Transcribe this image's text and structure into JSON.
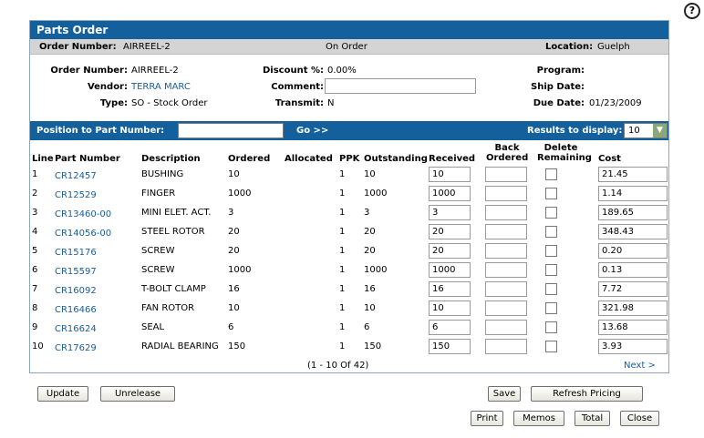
{
  "help_label": "?",
  "title": "Parts Order",
  "infobar": {
    "order_label": "Order Number:",
    "order_value": "AIRREEL-2",
    "status": "On Order",
    "location_label": "Location:",
    "location_value": "Guelph"
  },
  "details": {
    "order_number_label": "Order Number:",
    "order_number": "AIRREEL-2",
    "vendor_label": "Vendor:",
    "vendor": "TERRA MARC",
    "type_label": "Type:",
    "type": "SO - Stock Order",
    "discount_label": "Discount %:",
    "discount": "0.00%",
    "comment_label": "Comment:",
    "comment": "",
    "transmit_label": "Transmit:",
    "transmit": "N",
    "program_label": "Program:",
    "program": "",
    "ship_date_label": "Ship Date:",
    "ship_date": "",
    "due_date_label": "Due Date:",
    "due_date": "01/23/2009"
  },
  "position": {
    "label": "Position to Part Number:",
    "value": "",
    "go_label": "Go >>",
    "results_label": "Results to display:",
    "results_value": "10"
  },
  "columns": {
    "line": "Line",
    "part": "Part Number",
    "desc": "Description",
    "ordered": "Ordered",
    "allocated": "Allocated",
    "ppk": "PPK",
    "outstanding": "Outstanding",
    "received": "Received",
    "back1": "Back",
    "back2": "Ordered",
    "del1": "Delete",
    "del2": "Remaining",
    "cost": "Cost"
  },
  "rows": [
    {
      "line": "1",
      "part": "CR12457",
      "desc": "BUSHING",
      "ordered": "10",
      "allocated": "",
      "ppk": "1",
      "outstanding": "10",
      "received": "10",
      "back": "",
      "cost": "21.45"
    },
    {
      "line": "2",
      "part": "CR12529",
      "desc": "FINGER",
      "ordered": "1000",
      "allocated": "",
      "ppk": "1",
      "outstanding": "1000",
      "received": "1000",
      "back": "",
      "cost": "1.14"
    },
    {
      "line": "3",
      "part": "CR13460-00",
      "desc": "MINI ELET. ACT.",
      "ordered": "3",
      "allocated": "",
      "ppk": "1",
      "outstanding": "3",
      "received": "3",
      "back": "",
      "cost": "189.65"
    },
    {
      "line": "4",
      "part": "CR14056-00",
      "desc": "STEEL ROTOR",
      "ordered": "20",
      "allocated": "",
      "ppk": "1",
      "outstanding": "20",
      "received": "20",
      "back": "",
      "cost": "348.43"
    },
    {
      "line": "5",
      "part": "CR15176",
      "desc": "SCREW",
      "ordered": "20",
      "allocated": "",
      "ppk": "1",
      "outstanding": "20",
      "received": "20",
      "back": "",
      "cost": "0.20"
    },
    {
      "line": "6",
      "part": "CR15597",
      "desc": "SCREW",
      "ordered": "1000",
      "allocated": "",
      "ppk": "1",
      "outstanding": "1000",
      "received": "1000",
      "back": "",
      "cost": "0.13"
    },
    {
      "line": "7",
      "part": "CR16092",
      "desc": "T-BOLT CLAMP",
      "ordered": "16",
      "allocated": "",
      "ppk": "1",
      "outstanding": "16",
      "received": "16",
      "back": "",
      "cost": "7.72"
    },
    {
      "line": "8",
      "part": "CR16466",
      "desc": "FAN ROTOR",
      "ordered": "10",
      "allocated": "",
      "ppk": "1",
      "outstanding": "10",
      "received": "10",
      "back": "",
      "cost": "321.98"
    },
    {
      "line": "9",
      "part": "CR16624",
      "desc": "SEAL",
      "ordered": "6",
      "allocated": "",
      "ppk": "1",
      "outstanding": "6",
      "received": "6",
      "back": "",
      "cost": "13.68"
    },
    {
      "line": "10",
      "part": "CR17629",
      "desc": "RADIAL BEARING",
      "ordered": "150",
      "allocated": "",
      "ppk": "1",
      "outstanding": "150",
      "received": "150",
      "back": "",
      "cost": "3.93"
    }
  ],
  "pager": {
    "summary": "(1  -  10  Of  42)",
    "next_label": "Next >"
  },
  "buttons": {
    "update": "Update",
    "unrelease": "Unrelease",
    "save": "Save",
    "refresh": "Refresh Pricing",
    "print": "Print",
    "memos": "Memos",
    "total": "Total",
    "close": "Close"
  },
  "colors": {
    "header_blue": "#14609c",
    "link_blue": "#1a5d9a",
    "info_gray": "#d4d4d4"
  }
}
